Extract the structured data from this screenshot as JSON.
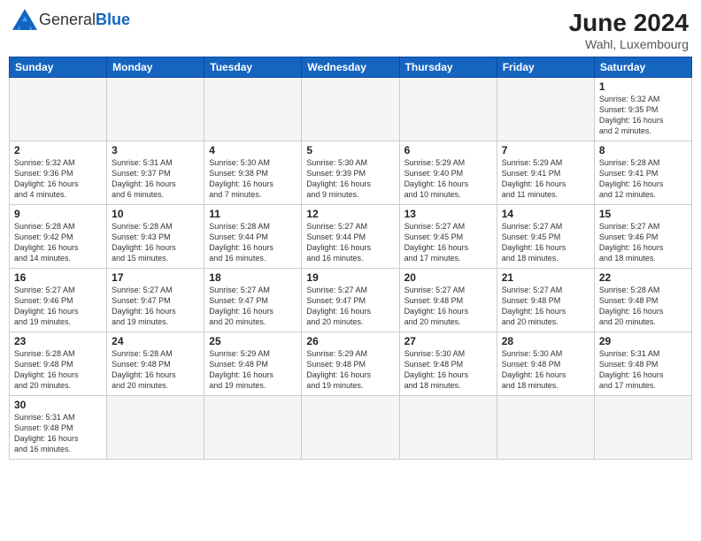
{
  "header": {
    "logo_general": "General",
    "logo_blue": "Blue",
    "month_year": "June 2024",
    "location": "Wahl, Luxembourg"
  },
  "weekdays": [
    "Sunday",
    "Monday",
    "Tuesday",
    "Wednesday",
    "Thursday",
    "Friday",
    "Saturday"
  ],
  "days": [
    {
      "num": "",
      "info": ""
    },
    {
      "num": "",
      "info": ""
    },
    {
      "num": "",
      "info": ""
    },
    {
      "num": "",
      "info": ""
    },
    {
      "num": "",
      "info": ""
    },
    {
      "num": "",
      "info": ""
    },
    {
      "num": "1",
      "info": "Sunrise: 5:32 AM\nSunset: 9:35 PM\nDaylight: 16 hours and 2 minutes."
    },
    {
      "num": "2",
      "info": "Sunrise: 5:32 AM\nSunset: 9:36 PM\nDaylight: 16 hours and 4 minutes."
    },
    {
      "num": "3",
      "info": "Sunrise: 5:31 AM\nSunset: 9:37 PM\nDaylight: 16 hours and 6 minutes."
    },
    {
      "num": "4",
      "info": "Sunrise: 5:30 AM\nSunset: 9:38 PM\nDaylight: 16 hours and 7 minutes."
    },
    {
      "num": "5",
      "info": "Sunrise: 5:30 AM\nSunset: 9:39 PM\nDaylight: 16 hours and 9 minutes."
    },
    {
      "num": "6",
      "info": "Sunrise: 5:29 AM\nSunset: 9:40 PM\nDaylight: 16 hours and 10 minutes."
    },
    {
      "num": "7",
      "info": "Sunrise: 5:29 AM\nSunset: 9:41 PM\nDaylight: 16 hours and 11 minutes."
    },
    {
      "num": "8",
      "info": "Sunrise: 5:28 AM\nSunset: 9:41 PM\nDaylight: 16 hours and 12 minutes."
    },
    {
      "num": "9",
      "info": "Sunrise: 5:28 AM\nSunset: 9:42 PM\nDaylight: 16 hours and 14 minutes."
    },
    {
      "num": "10",
      "info": "Sunrise: 5:28 AM\nSunset: 9:43 PM\nDaylight: 16 hours and 15 minutes."
    },
    {
      "num": "11",
      "info": "Sunrise: 5:28 AM\nSunset: 9:44 PM\nDaylight: 16 hours and 16 minutes."
    },
    {
      "num": "12",
      "info": "Sunrise: 5:27 AM\nSunset: 9:44 PM\nDaylight: 16 hours and 16 minutes."
    },
    {
      "num": "13",
      "info": "Sunrise: 5:27 AM\nSunset: 9:45 PM\nDaylight: 16 hours and 17 minutes."
    },
    {
      "num": "14",
      "info": "Sunrise: 5:27 AM\nSunset: 9:45 PM\nDaylight: 16 hours and 18 minutes."
    },
    {
      "num": "15",
      "info": "Sunrise: 5:27 AM\nSunset: 9:46 PM\nDaylight: 16 hours and 18 minutes."
    },
    {
      "num": "16",
      "info": "Sunrise: 5:27 AM\nSunset: 9:46 PM\nDaylight: 16 hours and 19 minutes."
    },
    {
      "num": "17",
      "info": "Sunrise: 5:27 AM\nSunset: 9:47 PM\nDaylight: 16 hours and 19 minutes."
    },
    {
      "num": "18",
      "info": "Sunrise: 5:27 AM\nSunset: 9:47 PM\nDaylight: 16 hours and 20 minutes."
    },
    {
      "num": "19",
      "info": "Sunrise: 5:27 AM\nSunset: 9:47 PM\nDaylight: 16 hours and 20 minutes."
    },
    {
      "num": "20",
      "info": "Sunrise: 5:27 AM\nSunset: 9:48 PM\nDaylight: 16 hours and 20 minutes."
    },
    {
      "num": "21",
      "info": "Sunrise: 5:27 AM\nSunset: 9:48 PM\nDaylight: 16 hours and 20 minutes."
    },
    {
      "num": "22",
      "info": "Sunrise: 5:28 AM\nSunset: 9:48 PM\nDaylight: 16 hours and 20 minutes."
    },
    {
      "num": "23",
      "info": "Sunrise: 5:28 AM\nSunset: 9:48 PM\nDaylight: 16 hours and 20 minutes."
    },
    {
      "num": "24",
      "info": "Sunrise: 5:28 AM\nSunset: 9:48 PM\nDaylight: 16 hours and 20 minutes."
    },
    {
      "num": "25",
      "info": "Sunrise: 5:29 AM\nSunset: 9:48 PM\nDaylight: 16 hours and 19 minutes."
    },
    {
      "num": "26",
      "info": "Sunrise: 5:29 AM\nSunset: 9:48 PM\nDaylight: 16 hours and 19 minutes."
    },
    {
      "num": "27",
      "info": "Sunrise: 5:30 AM\nSunset: 9:48 PM\nDaylight: 16 hours and 18 minutes."
    },
    {
      "num": "28",
      "info": "Sunrise: 5:30 AM\nSunset: 9:48 PM\nDaylight: 16 hours and 18 minutes."
    },
    {
      "num": "29",
      "info": "Sunrise: 5:31 AM\nSunset: 9:48 PM\nDaylight: 16 hours and 17 minutes."
    },
    {
      "num": "30",
      "info": "Sunrise: 5:31 AM\nSunset: 9:48 PM\nDaylight: 16 hours and 16 minutes."
    }
  ]
}
